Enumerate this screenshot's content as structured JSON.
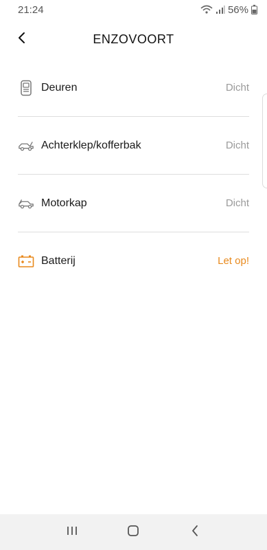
{
  "status_bar": {
    "time": "21:24",
    "battery_percent": "56%",
    "icons": [
      "wifi-icon",
      "signal-icon",
      "battery-icon"
    ]
  },
  "header": {
    "title": "ENZOVOORT",
    "back_icon": "chevron-left-icon"
  },
  "items": [
    {
      "label": "Deuren",
      "status": "Dicht",
      "icon": "door-icon",
      "status_color": "#9a9a9a"
    },
    {
      "label": "Achterklep/kofferbak",
      "status": "Dicht",
      "icon": "car-trunk-icon",
      "status_color": "#9a9a9a"
    },
    {
      "label": "Motorkap",
      "status": "Dicht",
      "icon": "car-hood-icon",
      "status_color": "#9a9a9a"
    },
    {
      "label": "Batterij",
      "status": "Let op!",
      "icon": "battery-warning-icon",
      "status_color": "#e8891c"
    }
  ],
  "nav_bar": {
    "buttons": [
      "recent-apps-icon",
      "home-icon",
      "back-icon"
    ]
  },
  "colors": {
    "accent_warning": "#e8891c",
    "text_muted": "#9a9a9a",
    "divider": "#dddddd"
  }
}
